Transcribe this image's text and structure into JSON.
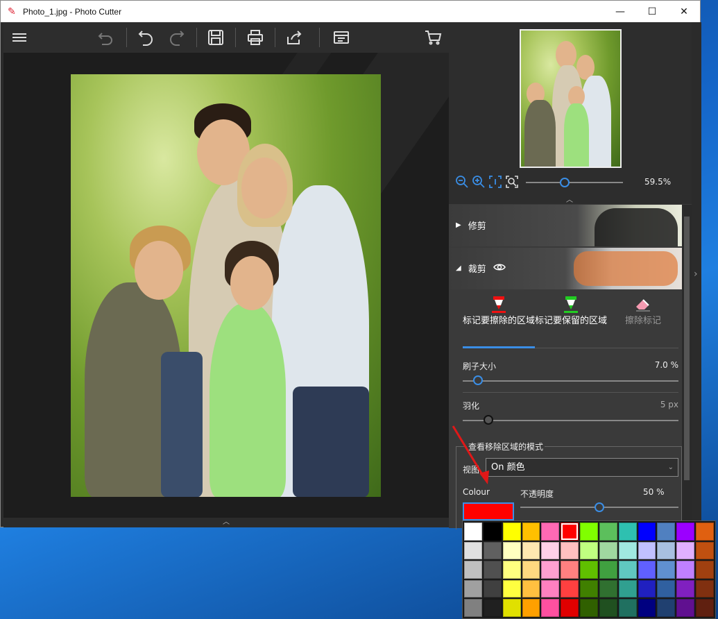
{
  "window": {
    "title": "Photo_1.jpg - Photo Cutter",
    "buttons": [
      "minimize",
      "maximize",
      "close"
    ]
  },
  "toolbar": {
    "items": [
      "menu-icon",
      "undo-history-icon",
      "undo-icon",
      "redo-icon",
      "save-icon",
      "print-icon",
      "share-icon",
      "export-icon",
      "cart-icon"
    ]
  },
  "zoom": {
    "value_label": "59.5%",
    "level": 0.4
  },
  "sections": {
    "trim": {
      "label": "修剪"
    },
    "cut": {
      "label": "裁剪"
    }
  },
  "tabs": [
    {
      "label": "标记要擦除的区域",
      "active": true,
      "icon": "red-marker-icon"
    },
    {
      "label": "标记要保留的区域",
      "active": false,
      "icon": "green-marker-icon"
    },
    {
      "label": "擦除标记",
      "active": false,
      "icon": "eraser-icon"
    }
  ],
  "brush": {
    "label": "刷子大小",
    "value": "7.0 %",
    "level": 0.07
  },
  "feather": {
    "label": "羽化",
    "value": "5 px",
    "level": 0.12
  },
  "mode_group": {
    "title": "查看移除区域的模式"
  },
  "view": {
    "label": "视图",
    "selected": "On 颜色"
  },
  "colour": {
    "label": "Colour",
    "value": "#ff0000"
  },
  "opacity": {
    "label": "不透明度",
    "value": "50 %",
    "level": 0.5
  },
  "palette": {
    "colors": [
      "#ffffff",
      "#000000",
      "#ffff00",
      "#ffc000",
      "#ff69b4",
      "#ff0000",
      "#80ff00",
      "#5cbf5c",
      "#2ec0b0",
      "#0000ff",
      "#5080c0",
      "#9b00ff",
      "#e06010",
      "#e0e0e0",
      "#606060",
      "#ffffc0",
      "#ffe8b0",
      "#ffd0e8",
      "#ffc0c0",
      "#c0ff80",
      "#a0d8a0",
      "#a0e8e0",
      "#c0c0ff",
      "#a8c0e0",
      "#e0b0ff",
      "#c05010",
      "#c0c0c0",
      "#505050",
      "#ffff80",
      "#ffd880",
      "#ffa0d0",
      "#ff8080",
      "#60c000",
      "#40a040",
      "#60c8c0",
      "#6060ff",
      "#6090d0",
      "#c080ff",
      "#a04010",
      "#a0a0a0",
      "#404040",
      "#ffff40",
      "#ffc040",
      "#ff80c0",
      "#ff4040",
      "#408000",
      "#307030",
      "#30a090",
      "#2020c0",
      "#3060a0",
      "#8020c0",
      "#803010",
      "#808080",
      "#202020",
      "#e0e000",
      "#ffa000",
      "#ff50a0",
      "#e00000",
      "#306000",
      "#205020",
      "#207060",
      "#000080",
      "#204070",
      "#601090",
      "#602010"
    ]
  }
}
